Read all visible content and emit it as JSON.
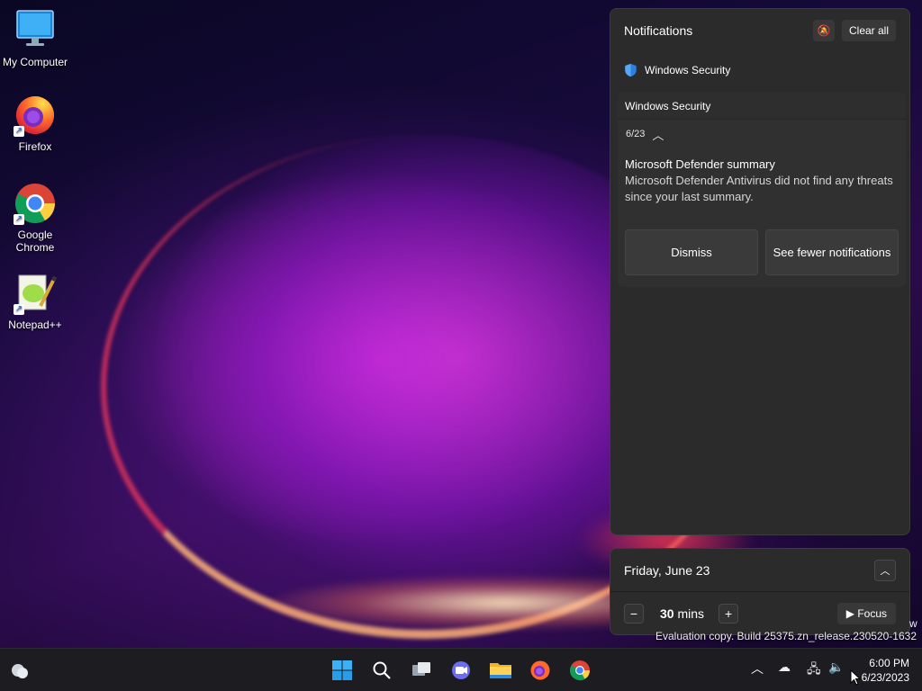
{
  "desktop": {
    "icons": [
      {
        "label": "My Computer",
        "icon": "monitor-icon"
      },
      {
        "label": "Firefox",
        "icon": "firefox-icon"
      },
      {
        "label": "Google Chrome",
        "icon": "chrome-icon"
      },
      {
        "label": "Notepad++",
        "icon": "notepadpp-icon"
      }
    ]
  },
  "notifications": {
    "title": "Notifications",
    "clear_all": "Clear all",
    "app_name": "Windows Security",
    "group_header": "Windows Security",
    "date": "6/23",
    "card_title": "Microsoft Defender summary",
    "card_body": "Microsoft Defender Antivirus did not find any threats since your last summary.",
    "dismiss": "Dismiss",
    "see_fewer": "See fewer notifications"
  },
  "calendar": {
    "date_label": "Friday, June 23",
    "focus_minutes": "30",
    "focus_unit": "mins",
    "focus_button": "Focus"
  },
  "watermark": {
    "line": "Evaluation copy. Build 25375.zn_release.230520-1632",
    "edge": "w"
  },
  "taskbar": {
    "apps": [
      "windows-start",
      "search",
      "task-view",
      "chat",
      "file-explorer",
      "firefox",
      "chrome"
    ],
    "time": "6:00 PM",
    "date": "6/23/2023"
  },
  "colors": {
    "accent": "#0078d4",
    "panel_bg": "#2b2b2b",
    "taskbar_bg": "#1d1c21"
  }
}
